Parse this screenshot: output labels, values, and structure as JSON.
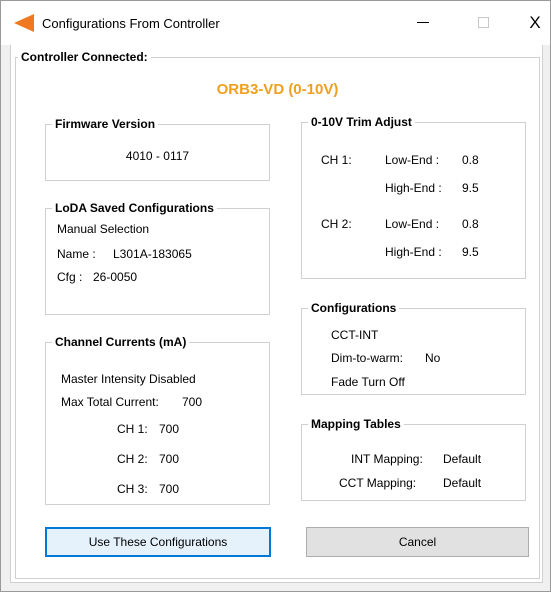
{
  "window": {
    "title": "Configurations From Controller",
    "controls": {
      "minimize": "—",
      "maximize": "☐",
      "close": "X"
    }
  },
  "controller": {
    "legend": "Controller Connected:",
    "device": "ORB3-VD (0-10V)"
  },
  "firmware": {
    "legend": "Firmware Version",
    "value": "4010 - 0117"
  },
  "loda": {
    "legend": "LoDA Saved Configurations",
    "selection": "Manual Selection",
    "name_label": "Name :",
    "name_value": "L301A-183065",
    "cfg_label": "Cfg :",
    "cfg_value": "26-0050"
  },
  "currents": {
    "legend": "Channel Currents (mA)",
    "master": "Master Intensity Disabled",
    "max_total_label": "Max Total Current:",
    "max_total_value": "700",
    "channels": [
      {
        "label": "CH 1:",
        "value": "700"
      },
      {
        "label": "CH 2:",
        "value": "700"
      },
      {
        "label": "CH 3:",
        "value": "700"
      }
    ]
  },
  "trim": {
    "legend": "0-10V Trim Adjust",
    "ch1_label": "CH 1:",
    "ch1_low_label": "Low-End :",
    "ch1_low_value": "0.8",
    "ch1_high_label": "High-End :",
    "ch1_high_value": "9.5",
    "ch2_label": "CH 2:",
    "ch2_low_label": "Low-End :",
    "ch2_low_value": "0.8",
    "ch2_high_label": "High-End :",
    "ch2_high_value": "9.5"
  },
  "configurations": {
    "legend": "Configurations",
    "mode": "CCT-INT",
    "dim_to_warm_label": "Dim-to-warm:",
    "dim_to_warm_value": "No",
    "fade": "Fade Turn Off"
  },
  "mapping": {
    "legend": "Mapping Tables",
    "int_label": "INT Mapping:",
    "int_value": "Default",
    "cct_label": "CCT Mapping:",
    "cct_value": "Default"
  },
  "buttons": {
    "use": "Use These Configurations",
    "cancel": "Cancel"
  },
  "colors": {
    "accent": "#f0a020",
    "focus_border": "#0078d7",
    "app_icon": "#f07820"
  }
}
